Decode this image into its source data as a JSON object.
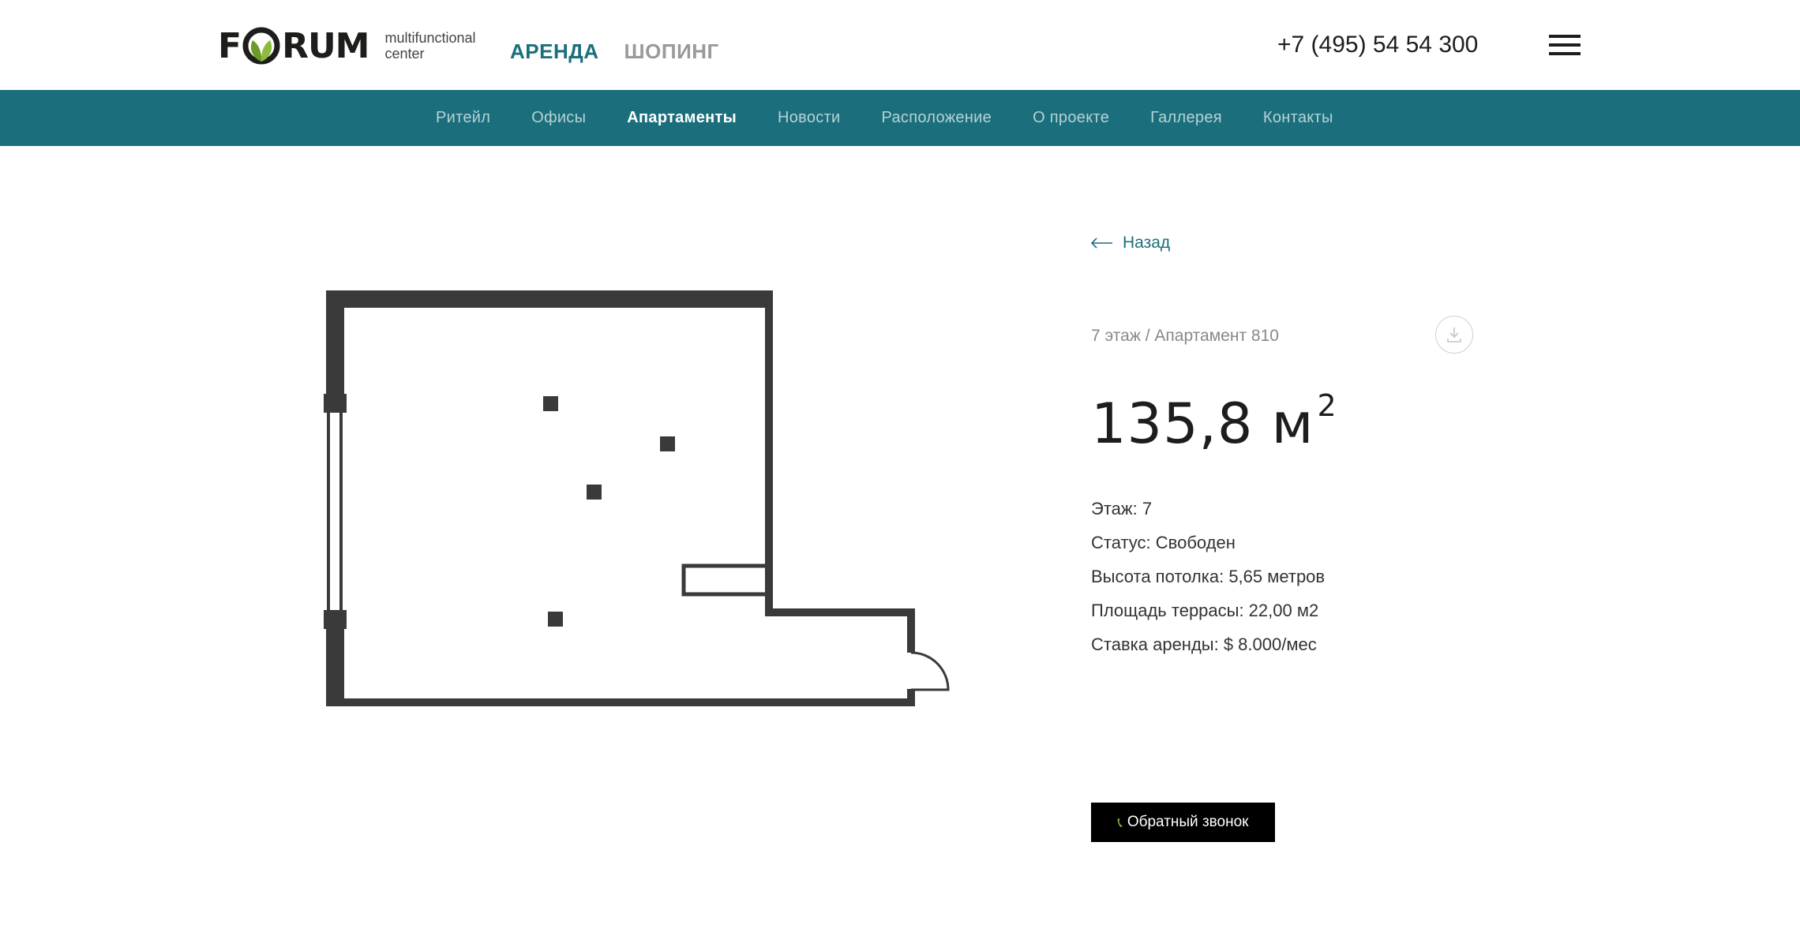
{
  "header": {
    "logo": {
      "word": "FORUM",
      "sub_line1": "multifunctional",
      "sub_line2": "center"
    },
    "tabs": [
      {
        "label": "АРЕНДА",
        "active": true
      },
      {
        "label": "ШОПИНГ",
        "active": false
      }
    ],
    "phone": "+7 (495) 54 54 300",
    "menu_icon": "hamburger-icon"
  },
  "nav": {
    "items": [
      {
        "label": "Ритейл",
        "active": false
      },
      {
        "label": "Офисы",
        "active": false
      },
      {
        "label": "Апартаменты",
        "active": true
      },
      {
        "label": "Новости",
        "active": false
      },
      {
        "label": "Расположение",
        "active": false
      },
      {
        "label": "О проекте",
        "active": false
      },
      {
        "label": "Галлерея",
        "active": false
      },
      {
        "label": "Контакты",
        "active": false
      }
    ]
  },
  "info": {
    "back_label": "Назад",
    "back_icon": "arrow-left-icon",
    "breadcrumb": "7 этаж / Апартамент 810",
    "download_icon": "download-icon",
    "area_value": "135,8 м",
    "area_sup": "2",
    "properties": [
      "Этаж: 7",
      "Статус: Свободен",
      "Высота потолка: 5,65 метров",
      "Площадь террасы: 22,00 м2",
      "Ставка аренды: $ 8.000/мес"
    ],
    "callback_icon": "phone-icon",
    "callback_label": "Обратный звонок"
  },
  "colors": {
    "brand_teal": "#1b6f7c",
    "logo_green": "#6a9a2a",
    "plan_wall": "#3a3a3a",
    "button_bg": "#000000"
  }
}
